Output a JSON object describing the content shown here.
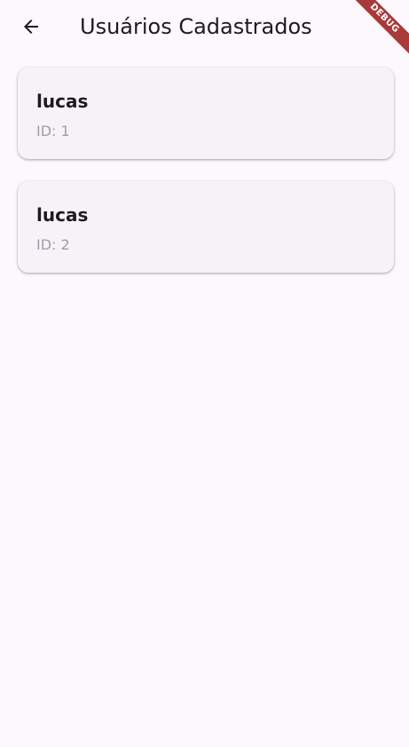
{
  "app_bar": {
    "title": "Usuários Cadastrados",
    "back_icon": "arrow-left-icon"
  },
  "debug_banner": {
    "label": "DEBUG"
  },
  "users": [
    {
      "name": "lucas",
      "id_text": "ID: 1"
    },
    {
      "name": "lucas",
      "id_text": "ID: 2"
    }
  ],
  "colors": {
    "background": "#fdf7fe",
    "card": "#f6f3f8",
    "text_primary": "#1d1b20",
    "text_secondary": "#a09ca6",
    "debug_banner": "#a83a3a"
  }
}
